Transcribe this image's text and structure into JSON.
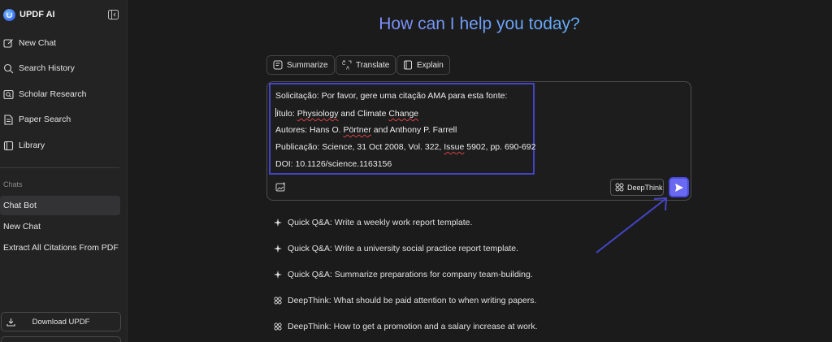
{
  "sidebar": {
    "brand": "UPDF AI",
    "nav": [
      {
        "label": "New Chat",
        "icon": "new-chat-icon"
      },
      {
        "label": "Search History",
        "icon": "search-icon"
      },
      {
        "label": "Scholar Research",
        "icon": "scholar-icon"
      },
      {
        "label": "Paper Search",
        "icon": "paper-icon"
      },
      {
        "label": "Library",
        "icon": "library-icon"
      }
    ],
    "chats_label": "Chats",
    "chats": [
      "Chat Bot",
      "New Chat",
      "Extract All Citations From PDF"
    ],
    "download_label": "Download UPDF"
  },
  "main": {
    "headline": "How can I help you today?",
    "actions": [
      "Summarize",
      "Translate",
      "Explain"
    ],
    "prompt": {
      "line1": "Solicitação: Por favor, gere uma citação AMA para esta fonte:",
      "line2_a": "ítulo: ",
      "line2_b": "Physiology",
      "line2_c": " and Climate ",
      "line2_d": "Change",
      "line3_a": "Autores: Hans O. ",
      "line3_b": "Pörtner",
      "line3_c": " and Anthony P. Farrell",
      "line4_a": "Publicação: Science, 31 Oct 2008, Vol. 322, ",
      "line4_b": "Issue",
      "line4_c": " 5902, pp. 690-692",
      "line5": "DOI: 10.1126/science.1163156"
    },
    "deepthink_label": "DeepThink",
    "suggestions": [
      {
        "type": "quick",
        "text": "Quick Q&A: Write a weekly work report template."
      },
      {
        "type": "quick",
        "text": "Quick Q&A: Write a university social practice report template."
      },
      {
        "type": "quick",
        "text": "Quick Q&A: Summarize preparations for company team-building."
      },
      {
        "type": "deepthink",
        "text": "DeepThink: What should be paid attention to when writing papers."
      },
      {
        "type": "deepthink",
        "text": "DeepThink: How to get a promotion and a salary increase at work."
      }
    ]
  },
  "colors": {
    "accent": "#6a6af0",
    "highlight_border": "#4343c5",
    "background": "#1b1b1c",
    "sidebar": "#232324"
  }
}
